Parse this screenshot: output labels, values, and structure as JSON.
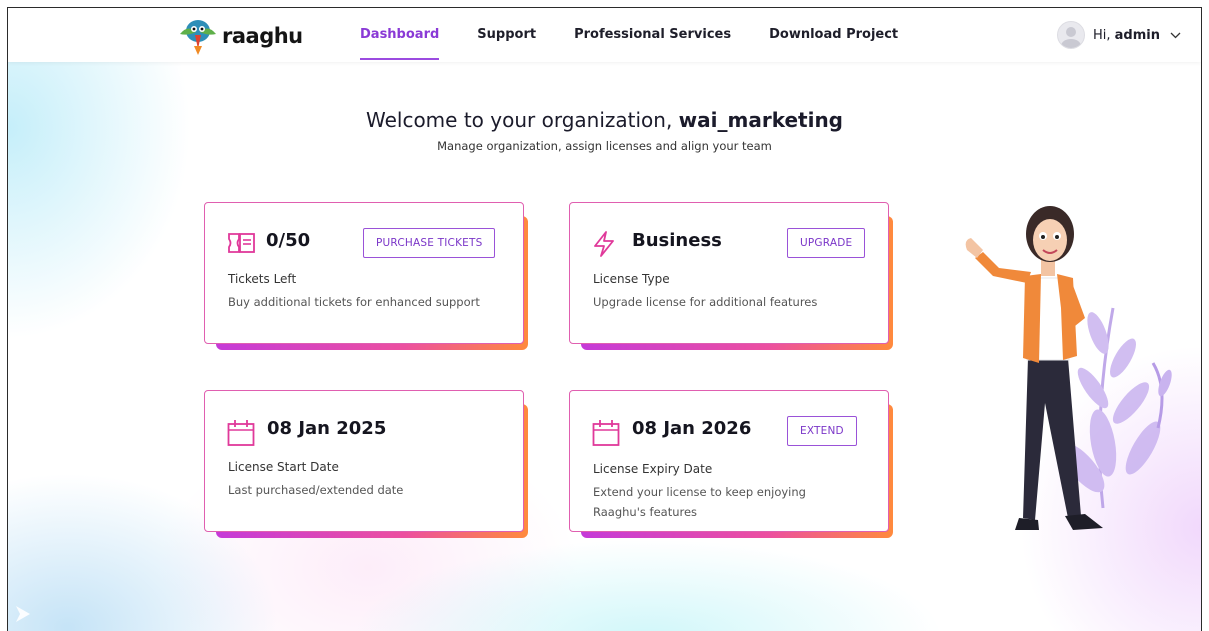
{
  "header": {
    "brand": "raaghu",
    "nav": [
      "Dashboard",
      "Support",
      "Professional Services",
      "Download Project"
    ],
    "active_nav": "Dashboard",
    "greeting": "Hi,",
    "username": "admin"
  },
  "welcome": {
    "prefix": "Welcome to your organization,",
    "org_name": "wai_marketing",
    "subtitle": "Manage organization, assign licenses and align your team"
  },
  "cards": [
    {
      "value": "0/50",
      "label": "Tickets Left",
      "desc": "Buy additional tickets for enhanced support",
      "button": "PURCHASE TICKETS",
      "icon": "ticket-icon"
    },
    {
      "value": "Business",
      "label": "License Type",
      "desc": "Upgrade license for additional features",
      "button": "UPGRADE",
      "icon": "lightning-icon"
    },
    {
      "value": "08 Jan 2025",
      "label": "License Start Date",
      "desc": "Last purchased/extended date",
      "icon": "calendar-icon"
    },
    {
      "value": "08 Jan 2026",
      "label": "License Expiry Date",
      "desc": "Extend your license to keep enjoying Raaghu's features",
      "button": "EXTEND",
      "icon": "calendar-icon"
    }
  ],
  "colors": {
    "accent": "#8a3ad6",
    "card_border": "#e05fb0",
    "gradient_start": "#c53ad8",
    "gradient_end": "#ff8a3d"
  }
}
